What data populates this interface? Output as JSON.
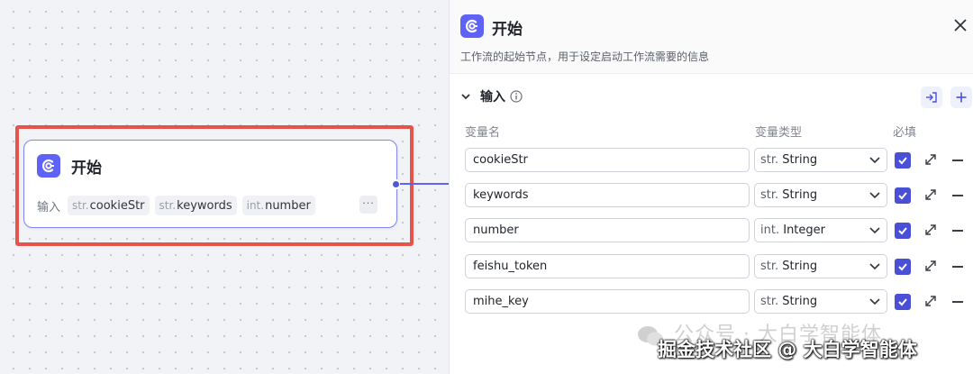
{
  "node": {
    "title": "开始",
    "inputs_label": "输入",
    "params": [
      {
        "type": "str.",
        "name": "cookieStr"
      },
      {
        "type": "str.",
        "name": "keywords"
      },
      {
        "type": "int.",
        "name": "number"
      }
    ],
    "more": "···"
  },
  "panel": {
    "title": "开始",
    "description": "工作流的起始节点，用于设定启动工作流需要的信息",
    "section_title": "输入",
    "columns": {
      "name": "变量名",
      "type": "变量类型",
      "required": "必填"
    },
    "rows": [
      {
        "name": "cookieStr",
        "type_prefix": "str.",
        "type": "String",
        "required": true
      },
      {
        "name": "keywords",
        "type_prefix": "str.",
        "type": "String",
        "required": true
      },
      {
        "name": "number",
        "type_prefix": "int.",
        "type": "Integer",
        "required": true
      },
      {
        "name": "feishu_token",
        "type_prefix": "str.",
        "type": "String",
        "required": true
      },
      {
        "name": "mihe_key",
        "type_prefix": "str.",
        "type": "String",
        "required": true
      }
    ]
  },
  "watermark": {
    "line1": "公众号 · 大白学智能体",
    "line2": "掘金技术社区 @ 大白学智能体"
  },
  "colors": {
    "accent": "#5f62f6",
    "highlight": "#e5534b",
    "checkbox": "#4a4fd8"
  },
  "icons": [
    "app-logo-icon",
    "close-icon",
    "chevron-down-icon",
    "info-icon",
    "import-icon",
    "plus-icon",
    "checkmark-icon",
    "expand-icon",
    "minus-icon"
  ]
}
